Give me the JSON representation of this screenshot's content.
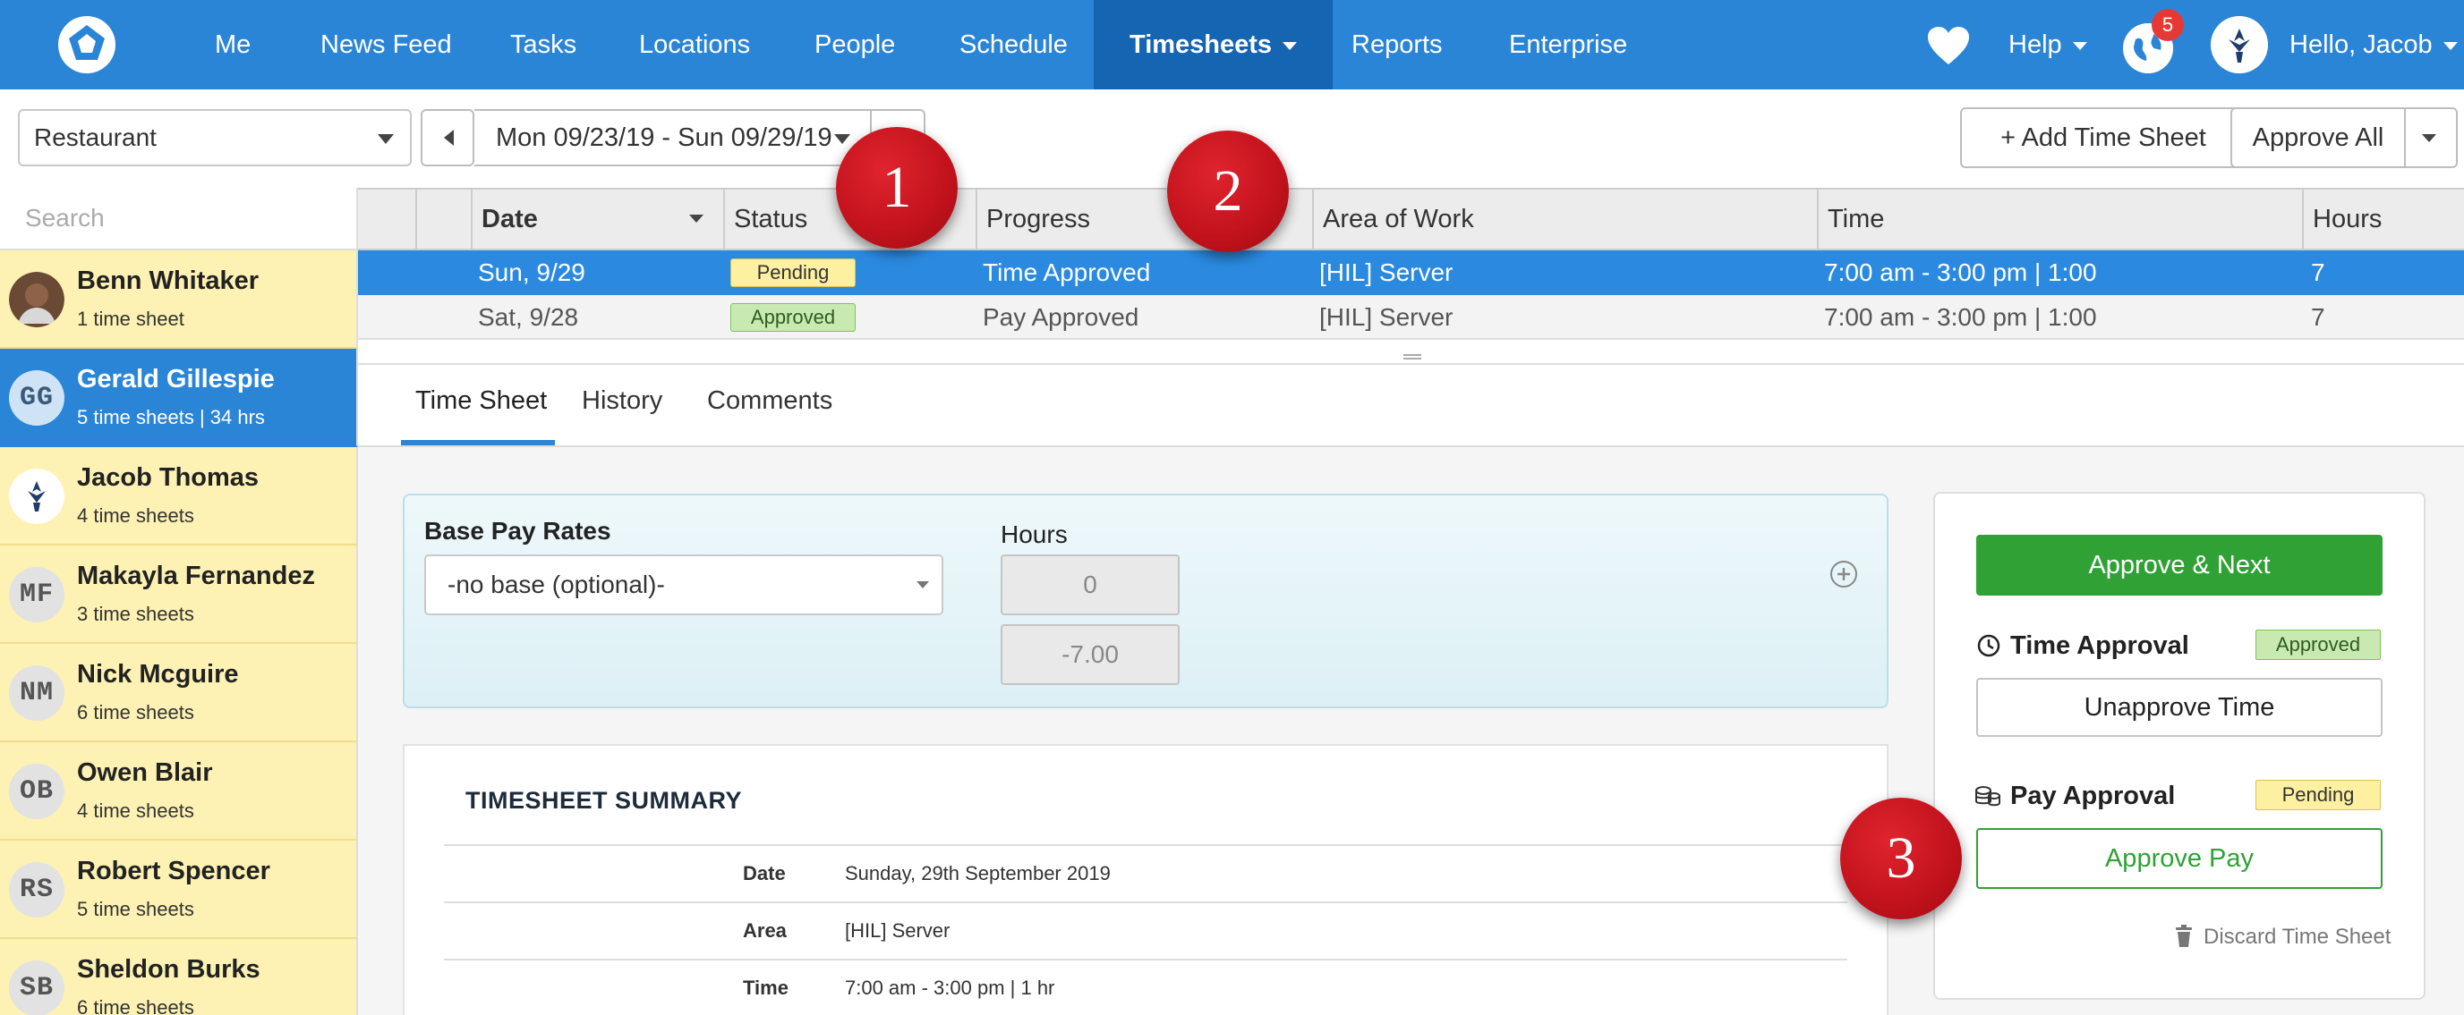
{
  "nav": {
    "items": [
      "Me",
      "News Feed",
      "Tasks",
      "Locations",
      "People",
      "Schedule",
      "Timesheets",
      "Reports",
      "Enterprise"
    ],
    "active": "Timesheets",
    "help_label": "Help",
    "notification_count": "5",
    "greeting": "Hello, Jacob",
    "accent_color": "#2b85d6",
    "active_color": "#1565b3"
  },
  "toolbar": {
    "location_value": "Restaurant",
    "date_range": "Mon 09/23/19 - Sun 09/29/19",
    "add_button": "+ Add Time Sheet",
    "approve_all_button": "Approve All"
  },
  "sidebar": {
    "search_placeholder": "Search",
    "employees": [
      {
        "initials": "",
        "name": "Benn Whitaker",
        "count": "1 time sheet",
        "photo": true
      },
      {
        "initials": "GG",
        "name": "Gerald Gillespie",
        "count": "5 time sheets | 34 hrs",
        "selected": true
      },
      {
        "initials": "",
        "name": "Jacob Thomas",
        "count": "4 time sheets",
        "photo": true
      },
      {
        "initials": "MF",
        "name": "Makayla Fernandez",
        "count": "3 time sheets"
      },
      {
        "initials": "NM",
        "name": "Nick Mcguire",
        "count": "6 time sheets"
      },
      {
        "initials": "OB",
        "name": "Owen Blair",
        "count": "4 time sheets"
      },
      {
        "initials": "RS",
        "name": "Robert Spencer",
        "count": "5 time sheets"
      },
      {
        "initials": "SB",
        "name": "Sheldon Burks",
        "count": "6 time sheets"
      }
    ]
  },
  "table": {
    "columns": [
      "Date",
      "Status",
      "Progress",
      "Area of Work",
      "Time",
      "Hours"
    ],
    "rows": [
      {
        "date": "Sun, 9/29",
        "status": "Pending",
        "progress": "Time Approved",
        "area": "[HIL] Server",
        "time": "7:00 am - 3:00 pm | 1:00",
        "hours": "7",
        "selected": true
      },
      {
        "date": "Sat, 9/28",
        "status": "Approved",
        "progress": "Pay Approved",
        "area": "[HIL] Server",
        "time": "7:00 am - 3:00 pm | 1:00",
        "hours": "7"
      }
    ]
  },
  "tabs": [
    "Time Sheet",
    "History",
    "Comments"
  ],
  "base_pay": {
    "label": "Base Pay Rates",
    "select_value": "-no base (optional)-",
    "hours_label": "Hours",
    "hours_value": "0",
    "hours_diff": "-7.00"
  },
  "summary": {
    "title": "TIMESHEET SUMMARY",
    "rows": [
      {
        "key": "Date",
        "value": "Sunday, 29th September 2019"
      },
      {
        "key": "Area",
        "value": "[HIL] Server"
      },
      {
        "key": "Time",
        "value": "7:00 am - 3:00 pm | 1 hr"
      }
    ]
  },
  "approval": {
    "approve_next": "Approve & Next",
    "time_approval_label": "Time Approval",
    "time_status": "Approved",
    "unapprove_time": "Unapprove Time",
    "pay_approval_label": "Pay Approval",
    "pay_status": "Pending",
    "approve_pay": "Approve Pay",
    "discard": "Discard Time Sheet",
    "green": "#2fa135"
  },
  "callouts": [
    "1",
    "2",
    "3"
  ]
}
